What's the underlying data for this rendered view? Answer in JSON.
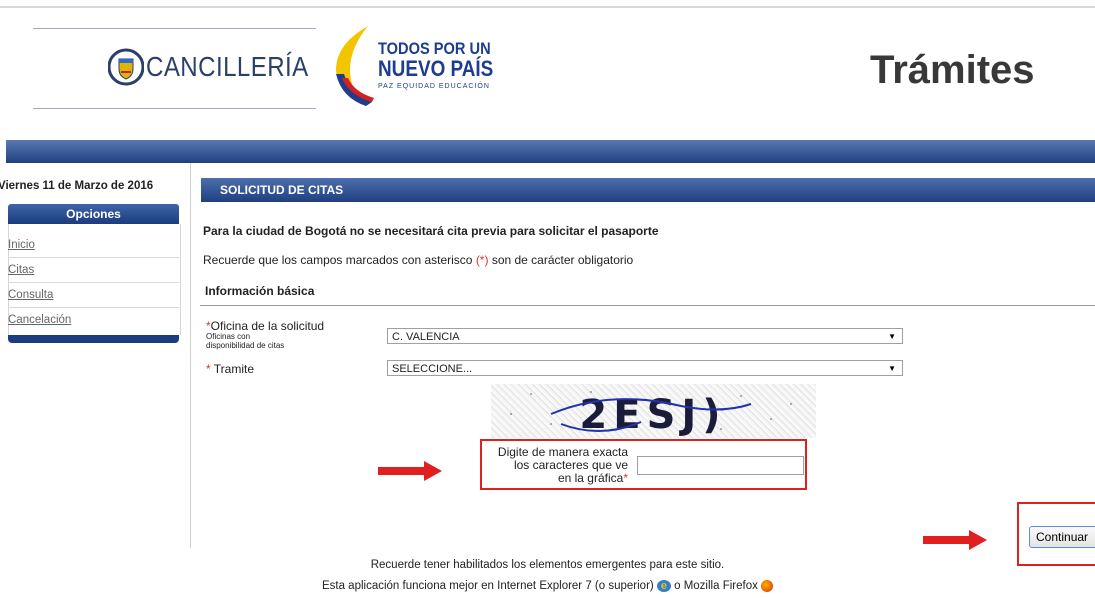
{
  "header": {
    "cancilleria": "CANCILLERÍA",
    "slogan_line1": "TODOS POR UN",
    "slogan_line2": "NUEVO PAÍS",
    "slogan_line3": "PAZ  EQUIDAD  EDUCACIÓN",
    "tramites": "Trámites"
  },
  "sidebar": {
    "date": "Viernes 11 de Marzo de 2016",
    "heading": "Opciones",
    "items": [
      {
        "label": "Inicio"
      },
      {
        "label": "Citas"
      },
      {
        "label": "Consulta"
      },
      {
        "label": "Cancelación"
      }
    ]
  },
  "main": {
    "section_title": "SOLICITUD DE CITAS",
    "notice": "Para la ciudad de Bogotá no se necesitará cita previa para solicitar el pasaporte",
    "required_pre": "Recuerde que los campos marcados con asterisco ",
    "required_mark": "(*)",
    "required_post": " son de carácter obligatorio",
    "info_heading": "Información básica",
    "office_label": "Oficina de la solicitud",
    "office_sub1": "Oficinas con",
    "office_sub2": "disponibilidad de citas",
    "office_value": "C. VALENCIA",
    "tramite_label": " Tramite",
    "tramite_value": "SELECCIONE...",
    "asterisk": "*",
    "captcha_text": "2ESJ)",
    "captcha_label1": "Digite de manera exacta",
    "captcha_label2": "los caracteres que ve",
    "captcha_label3": "en la gráfica",
    "captcha_value": "",
    "continue_label": "Continuar"
  },
  "footer": {
    "line1": "Recuerde tener habilitados los elementos emergentes para este sitio.",
    "line2a": "Esta aplicación funciona mejor en Internet Explorer 7 (o superior) ",
    "line2b": " o Mozilla Firefox "
  },
  "colors": {
    "bar_blue": "#1f3f7f",
    "highlight_red": "#e02020",
    "arrow_red": "#e02020"
  }
}
